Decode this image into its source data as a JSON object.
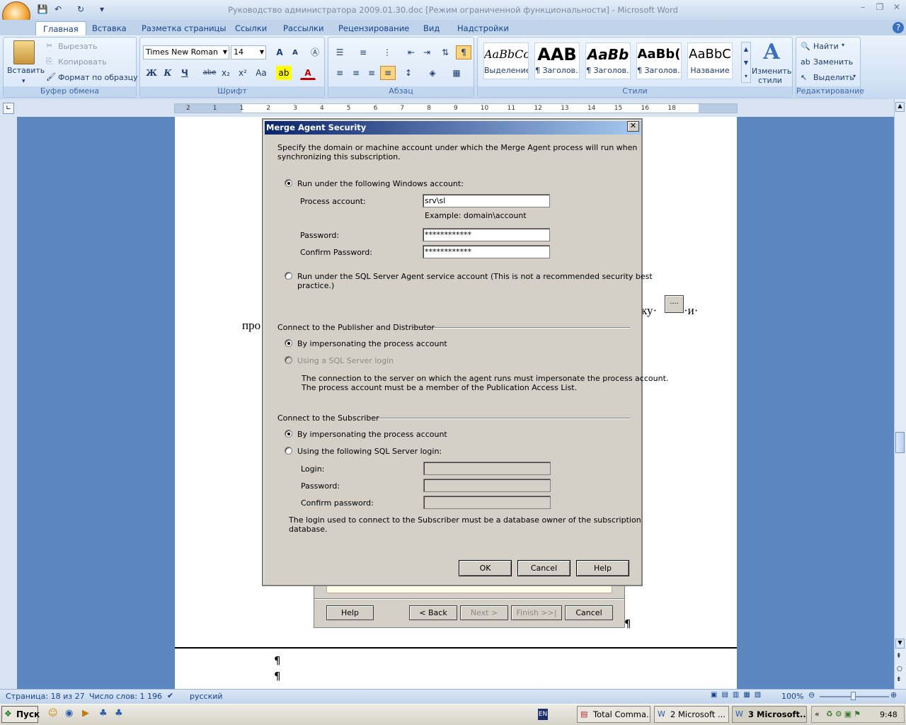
{
  "window": {
    "title": "Руководство администратора 2009.01.30.doc [Режим ограниченной функциональности] - Microsoft Word",
    "min": "–",
    "max": "❐",
    "close": "✕"
  },
  "ribbon": {
    "tabs": [
      "Главная",
      "Вставка",
      "Разметка страницы",
      "Ссылки",
      "Рассылки",
      "Рецензирование",
      "Вид",
      "Надстройки"
    ],
    "clipboard": {
      "paste": "Вставить",
      "cut": "Вырезать",
      "copy": "Копировать",
      "format_painter": "Формат по образцу",
      "label": "Буфер обмена"
    },
    "font": {
      "name": "Times New Roman",
      "size": "14",
      "label": "Шрифт",
      "bold": "Ж",
      "italic": "К",
      "underline": "Ч",
      "strike": "abe",
      "sub": "x₂",
      "sup": "x²",
      "case": "Aa",
      "grow": "A",
      "shrink": "A"
    },
    "paragraph": {
      "label": "Абзац"
    },
    "styles": {
      "label": "Стили",
      "items": [
        {
          "sample": "AaBbCc",
          "name": "Выделение"
        },
        {
          "sample": "AAB",
          "name": "¶ Заголов..."
        },
        {
          "sample": "AaBb",
          "name": "¶ Заголов..."
        },
        {
          "sample": "AaBb(",
          "name": "¶ Заголов..."
        },
        {
          "sample": "AaBbC",
          "name": "Название"
        }
      ],
      "change": "Изменить стили"
    },
    "editing": {
      "label": "Редактирование",
      "find": "Найти",
      "replace": "Заменить",
      "select": "Выделить"
    }
  },
  "ruler": {
    "marks": [
      "2",
      "1",
      "1",
      "2",
      "3",
      "4",
      "5",
      "6",
      "7",
      "8",
      "9",
      "10",
      "11",
      "12",
      "13",
      "14",
      "15",
      "16",
      "18"
    ]
  },
  "document": {
    "text_right": "ку·",
    "text_right2": "·и·",
    "text_left": "про",
    "para_mark": "¶"
  },
  "wizard": {
    "help": "Help",
    "back": "< Back",
    "next": "Next >",
    "finish": "Finish >>|",
    "cancel": "Cancel"
  },
  "dialog": {
    "title": "Merge Agent Security",
    "intro_1": "Specify the domain or machine account under which the Merge Agent process will run when",
    "intro_2": "synchronizing this subscription.",
    "run_windows": "Run under the following Windows account:",
    "process_account_label": "Process account:",
    "process_account_value": "srv\\sl",
    "example": "Example: domain\\account",
    "password_label": "Password:",
    "password_value": "************",
    "confirm_label": "Confirm Password:",
    "confirm_value": "************",
    "run_agent_1": "Run under the SQL Server Agent service account (This is not a recommended security best",
    "run_agent_2": "practice.)",
    "connect_pub": "Connect to the Publisher and Distributor",
    "pub_impersonate": "By impersonating the process account",
    "pub_sql": "Using a SQL Server login",
    "pub_note_1": "The connection to the server on which the agent runs must impersonate the process account.",
    "pub_note_2": "The process account must be a member of the Publication Access List.",
    "connect_sub": "Connect to the Subscriber",
    "sub_impersonate": "By impersonating the process account",
    "sub_sql": "Using the following SQL Server login:",
    "login_label": "Login:",
    "sub_password_label": "Password:",
    "sub_confirm_label": "Confirm password:",
    "sub_note_1": "The login used to connect to the Subscriber must be a database owner of the subscription",
    "sub_note_2": "database.",
    "ok": "OK",
    "cancel": "Cancel",
    "help": "Help"
  },
  "status": {
    "page": "Страница: 18 из 27",
    "words": "Число слов: 1 196",
    "lang": "русский",
    "zoom": "100%"
  },
  "taskbar": {
    "start": "Пуск",
    "lang": "EN",
    "tasks": [
      "Total Comma...",
      "2 Microsoft ...",
      "3 Microsoft..."
    ],
    "clock": "9:48"
  }
}
